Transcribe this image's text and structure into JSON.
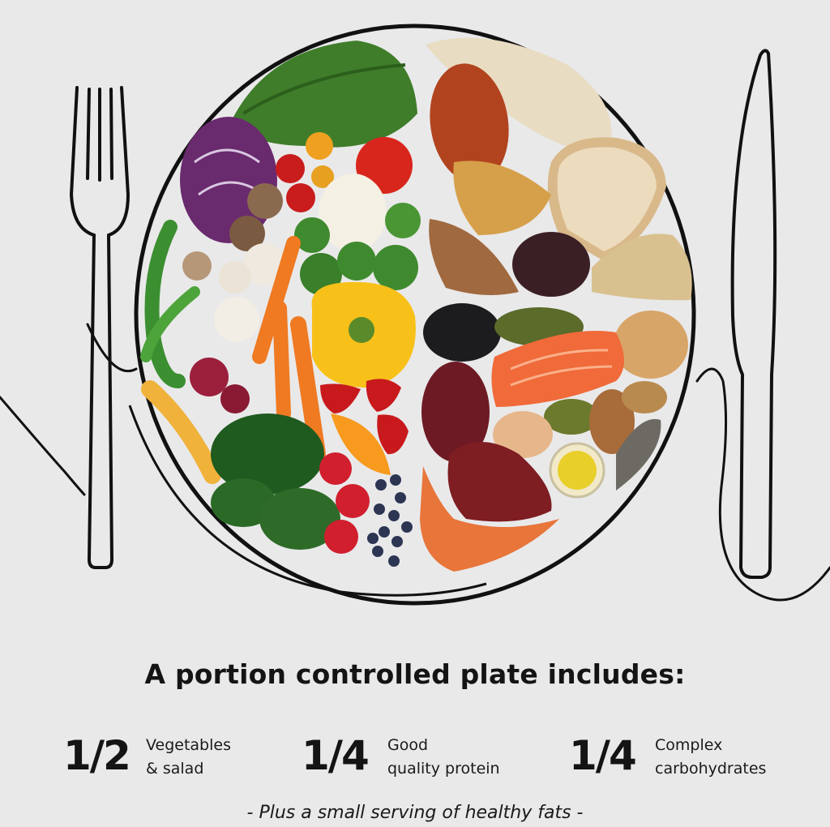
{
  "headline": "A portion controlled plate includes:",
  "portions": [
    {
      "fraction": "1/2",
      "line1": "Vegetables",
      "line2": "& salad"
    },
    {
      "fraction": "1/4",
      "line1": "Good",
      "line2": "quality protein"
    },
    {
      "fraction": "1/4",
      "line1": "Complex",
      "line2": "carbohydrates"
    }
  ],
  "footnote": "- Plus a small serving of healthy fats -",
  "illustration": {
    "icons": [
      "fork-icon",
      "knife-icon",
      "plate-icon"
    ],
    "background_color": "#e9e9ea",
    "line_color": "#111111"
  }
}
